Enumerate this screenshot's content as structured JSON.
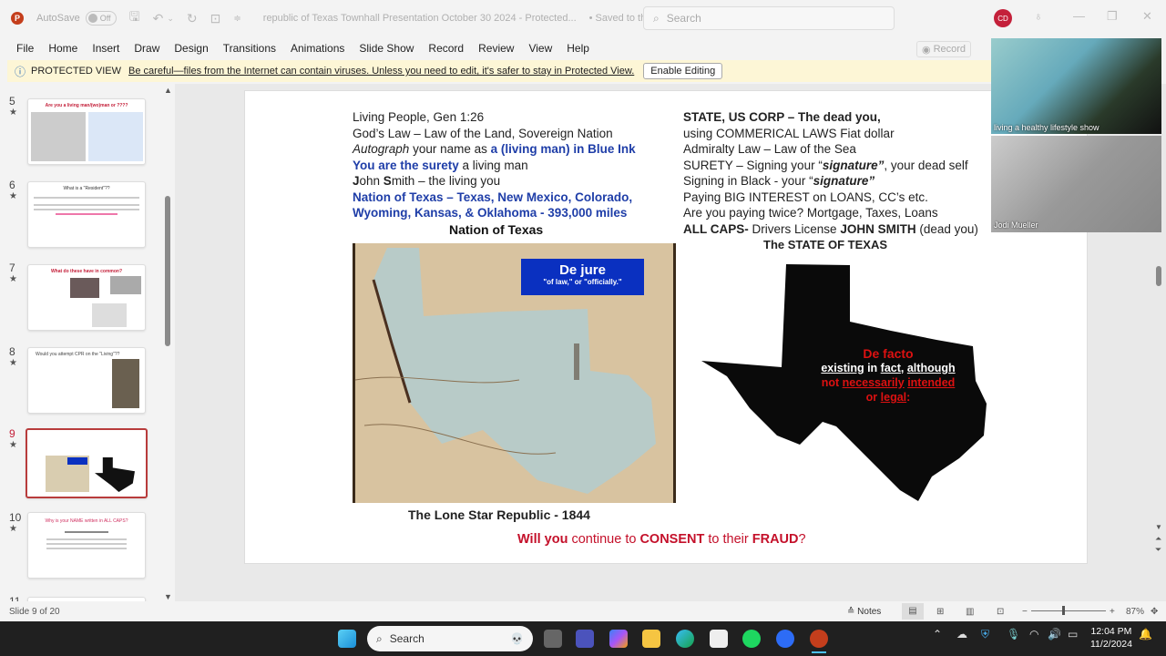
{
  "titlebar": {
    "app_icon": "powerpoint-icon",
    "autosave_label": "AutoSave",
    "autosave_state": "Off",
    "doc_title": "republic of Texas Townhall Presentation October 30 2024  -  Protected...",
    "save_status": "• Saved to this PC",
    "search_placeholder": "Search",
    "user_initials": "CD"
  },
  "menu": [
    "File",
    "Home",
    "Insert",
    "Draw",
    "Design",
    "Transitions",
    "Animations",
    "Slide Show",
    "Record",
    "Review",
    "View",
    "Help"
  ],
  "record_button": "Record",
  "protected_view": {
    "label": "PROTECTED VIEW",
    "message": "Be careful—files from the Internet can contain viruses. Unless you need to edit, it's safer to stay in Protected View.",
    "button": "Enable Editing"
  },
  "thumbnails": [
    {
      "num": "5",
      "title": "Are you a living man/(wo)man or ????"
    },
    {
      "num": "6",
      "title": "What is a \"Resident\"??"
    },
    {
      "num": "7",
      "title": "What do these have in common?"
    },
    {
      "num": "8",
      "title": "Would you attempt CPR on the \"Living\"??"
    },
    {
      "num": "9",
      "title": "",
      "active": true
    },
    {
      "num": "10",
      "title": "Why is your NAME written in ALL CAPS?"
    },
    {
      "num": "11",
      "title": ""
    }
  ],
  "slide": {
    "left": {
      "line1": "Living People,  Gen 1:26",
      "line2": "God’s Law – Law of the Land, Sovereign Nation",
      "line3_italic": "Autograph",
      "line3_rest": " your name as ",
      "line3_blue": "a (living man) in Blue Ink",
      "line4_blue": "You are the surety",
      "line4_rest": " a living man",
      "line5_j": "J",
      "line5_a": "ohn ",
      "line5_s": "S",
      "line5_b": "mith – the living you",
      "line6": "Nation of Texas – Texas, New Mexico, Colorado,",
      "line7": "Wyoming, Kansas, & Oklahoma  - 393,000 miles",
      "title": "Nation of Texas"
    },
    "right": {
      "line1": "STATE, US CORP – The dead you,",
      "line2": "using COMMERICAL LAWS Fiat dollar",
      "line3": "Admiralty Law – Law of the Sea",
      "line4_a": "SURETY – Signing your “",
      "line4_b": "signature”",
      "line4_c": ", your dead self",
      "line5_a": "Signing in Black  - your “",
      "line5_b": "signature”",
      "line6": "Paying BIG INTEREST on LOANS, CC’s etc.",
      "line7": "Are you paying twice?  Mortgage, Taxes, Loans",
      "line8_a": "ALL CAPS-",
      "line8_b": "  Drivers License ",
      "line8_c": "JOHN SMITH",
      "line8_d": " (dead you)",
      "title": "The STATE OF TEXAS"
    },
    "dejure": {
      "title": "De jure",
      "subtitle": "\"of law,\" or \"officially.\""
    },
    "map_caption": "The Lone Star Republic - 1844",
    "defacto": {
      "title": "De facto",
      "w1": "existing",
      "w2": " in ",
      "w3": "fact",
      "w4": ", ",
      "w5": "although",
      "r1": "not ",
      "r2": "necessarily",
      "r3": " ",
      "r4": "intended",
      "r5": "or ",
      "r6": "legal",
      "r7": ":"
    },
    "question": {
      "a": "Will you",
      "b": " continue to ",
      "c": "CONSENT",
      "d": " to their ",
      "e": "FRAUD",
      "f": "?"
    }
  },
  "video": {
    "participant1": "living a healthy lifestyle show",
    "participant2": "Jodi Mueller"
  },
  "statusbar": {
    "slide_info": "Slide 9 of 20",
    "notes": "Notes",
    "zoom": "87%"
  },
  "taskbar": {
    "search": "Search",
    "time": "12:04 PM",
    "date": "11/2/2024"
  }
}
